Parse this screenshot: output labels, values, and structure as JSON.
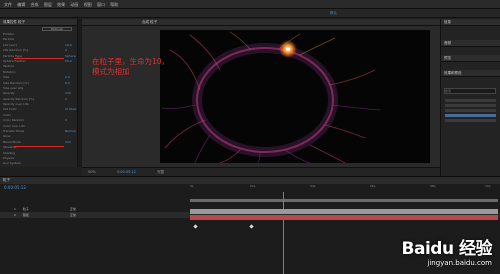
{
  "menubar": {
    "items": [
      "文件",
      "编辑",
      "合成",
      "图层",
      "效果",
      "动画",
      "视图",
      "窗口",
      "帮助"
    ]
  },
  "toolbar": {
    "workspace_link": "默认"
  },
  "left_panel": {
    "tab": "效果控件 粒子",
    "preset_button": "Particular",
    "properties": [
      {
        "label": "Emitter",
        "value": ""
      },
      {
        "label": "Particle",
        "value": ""
      },
      {
        "label": "Life [sec]",
        "value": "10.0"
      },
      {
        "label": "Life Random [%]",
        "value": "0"
      },
      {
        "label": "Particle Type",
        "value": "Sphere"
      },
      {
        "label": "Sphere Feather",
        "value": "50.0"
      },
      {
        "label": "Texture",
        "value": ""
      },
      {
        "label": "Rotation",
        "value": ""
      },
      {
        "label": "Size",
        "value": "2.0"
      },
      {
        "label": "Size Random [%]",
        "value": "0.0"
      },
      {
        "label": "Size over Life",
        "value": ""
      },
      {
        "label": "Opacity",
        "value": "100"
      },
      {
        "label": "Opacity Random [%]",
        "value": "0"
      },
      {
        "label": "Opacity over Life",
        "value": ""
      },
      {
        "label": "Set Color",
        "value": "At Start"
      },
      {
        "label": "Color",
        "value": ""
      },
      {
        "label": "Color Random",
        "value": "0"
      },
      {
        "label": "Color over Life",
        "value": ""
      },
      {
        "label": "Transfer Mode",
        "value": "Normal"
      },
      {
        "label": "Glow",
        "value": ""
      },
      {
        "label": "Blend Mode",
        "value": "Add"
      },
      {
        "label": "Streaklet",
        "value": ""
      },
      {
        "label": "Shading",
        "value": ""
      },
      {
        "label": "Physics",
        "value": ""
      },
      {
        "label": "Aux System",
        "value": ""
      }
    ]
  },
  "annotation": {
    "line1": "在粒子里，生命为10，",
    "line2": "模式为相加"
  },
  "composition": {
    "tab": "合成 粒子",
    "viewer_zoom": "50%",
    "timecode": "0:00:05:12",
    "resolution": "完整"
  },
  "right_panel": {
    "sections": [
      "信息",
      "音频",
      "预览",
      "效果和预设"
    ],
    "search_placeholder": "搜索"
  },
  "timeline": {
    "tab": "粒子",
    "timecode": "0:00:05:12",
    "layers": [
      {
        "index": "1",
        "name": "粒子",
        "mode": "正常"
      },
      {
        "index": "2",
        "name": "路径",
        "mode": "正常"
      }
    ],
    "ruler_labels": [
      "0s",
      "02s",
      "04s",
      "06s",
      "08s",
      "10s"
    ]
  },
  "watermark": {
    "brand": "Baidu 经验",
    "url": "jingyan.baidu.com"
  },
  "colors": {
    "accent": "#3a8fd6",
    "annotation": "#e23030",
    "layer_bar": "#b84a4a"
  }
}
